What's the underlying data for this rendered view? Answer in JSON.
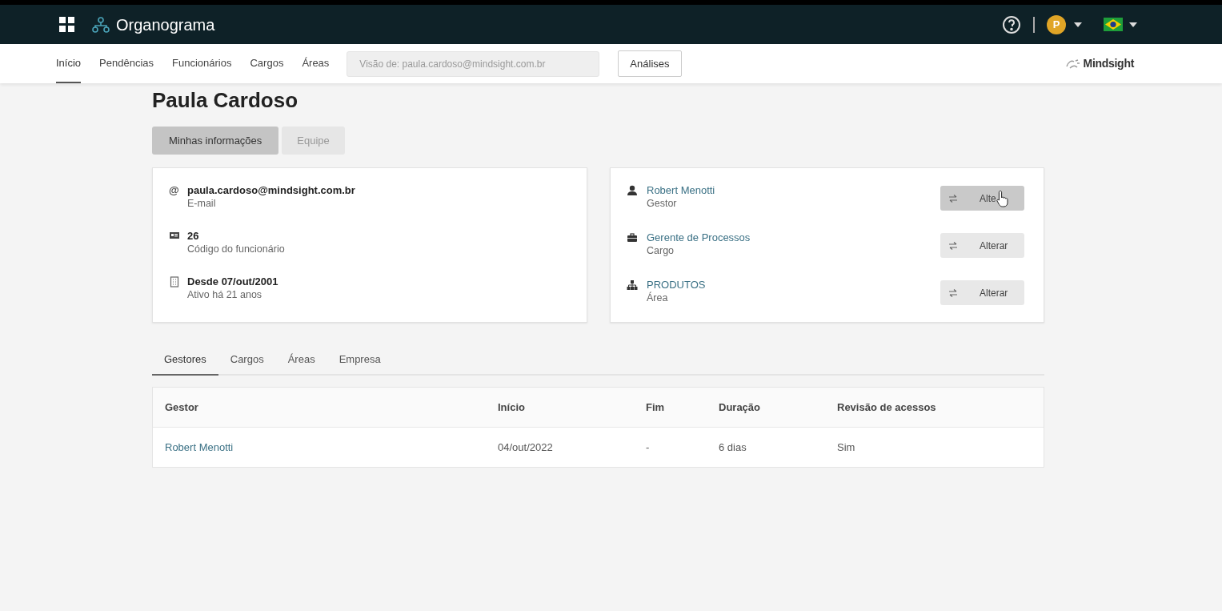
{
  "app": {
    "title": "Organograma"
  },
  "topbar": {
    "user_initial": "P"
  },
  "nav": {
    "items": [
      {
        "label": "Início",
        "selected": true
      },
      {
        "label": "Pendências",
        "selected": false
      },
      {
        "label": "Funcionários",
        "selected": false
      },
      {
        "label": "Cargos",
        "selected": false
      },
      {
        "label": "Áreas",
        "selected": false
      }
    ],
    "view_field": {
      "placeholder": "Visão de: paula.cardoso@mindsight.com.br"
    },
    "analyses_button": "Análises",
    "brand": "Mindsight"
  },
  "profile": {
    "name": "Paula Cardoso",
    "tabs": [
      {
        "label": "Minhas informações",
        "selected": true
      },
      {
        "label": "Equipe",
        "selected": false
      }
    ],
    "info": [
      {
        "kind": "email",
        "symbol": "@",
        "value": "paula.cardoso@mindsight.com.br",
        "caption": "E-mail"
      },
      {
        "kind": "id",
        "value": "26",
        "caption": "Código do funcionário"
      },
      {
        "kind": "since",
        "value": "Desde 07/out/2001",
        "caption": "Ativo há 21 anos"
      }
    ],
    "links": [
      {
        "kind": "person",
        "value": "Robert Menotti",
        "caption": "Gestor",
        "button": "Alte",
        "hovered": true
      },
      {
        "kind": "job",
        "value": "Gerente de Processos",
        "caption": "Cargo",
        "button": "Alterar",
        "hovered": false
      },
      {
        "kind": "area",
        "value": "PRODUTOS",
        "caption": "Área",
        "button": "Alterar",
        "hovered": false
      }
    ]
  },
  "history": {
    "tabs": [
      {
        "label": "Gestores",
        "selected": true
      },
      {
        "label": "Cargos",
        "selected": false
      },
      {
        "label": "Áreas",
        "selected": false
      },
      {
        "label": "Empresa",
        "selected": false
      }
    ],
    "columns": [
      "Gestor",
      "Início",
      "Fim",
      "Duração",
      "Revisão de acessos"
    ],
    "rows": [
      [
        "Robert Menotti",
        "04/out/2022",
        "-",
        "6 dias",
        "Sim"
      ]
    ]
  }
}
